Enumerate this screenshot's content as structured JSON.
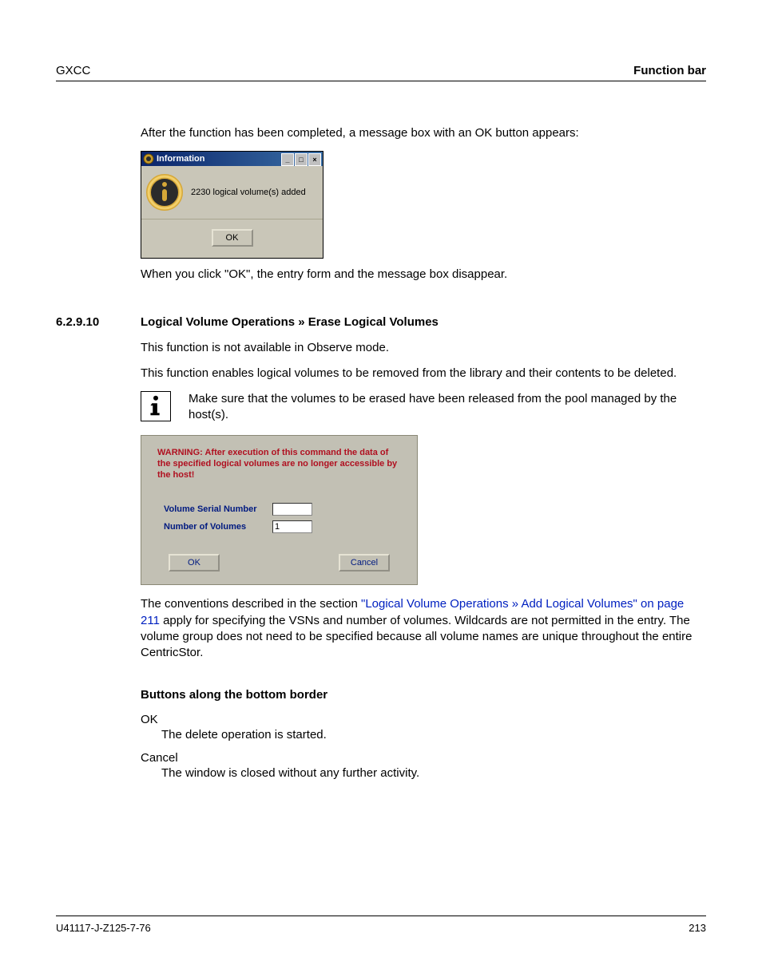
{
  "header": {
    "left": "GXCC",
    "right": "Function bar"
  },
  "intro": "After the function has been completed, a message box with an OK button appears:",
  "info_window": {
    "title": "Information",
    "message": "2230 logical volume(s) added",
    "ok": "OK"
  },
  "after_ok": "When you click \"OK\", the entry form and the message box disappear.",
  "section": {
    "number": "6.2.9.10",
    "title": "Logical Volume Operations » Erase Logical Volumes"
  },
  "body": {
    "p1": "This function is not available in Observe mode.",
    "p2": "This function enables logical volumes to be removed from the library and their contents to be deleted.",
    "note": "Make sure that the volumes to be erased have been released from the pool managed by the host(s).",
    "conventions_pre": "The conventions described in the section ",
    "conventions_link": "\"Logical Volume Operations » Add Logical Volumes\" on page 211",
    "conventions_post": " apply for specifying the VSNs and number of volumes. Wildcards are not permitted in the entry. The volume group does not need to be specified because all volume names are unique throughout the entire CentricStor."
  },
  "erase_form": {
    "warning": "WARNING: After execution of this command the data of the specified logical volumes are no longer accessible by the host!",
    "labels": {
      "vsn": "Volume Serial Number",
      "num": "Number of Volumes"
    },
    "values": {
      "vsn": "",
      "num": "1"
    },
    "ok": "OK",
    "cancel": "Cancel"
  },
  "buttons_section": {
    "title": "Buttons along the bottom border",
    "ok_term": "OK",
    "ok_desc": "The delete operation is started.",
    "cancel_term": "Cancel",
    "cancel_desc": "The window is closed without any further activity."
  },
  "footer": {
    "doc_id": "U41117-J-Z125-7-76",
    "page": "213"
  }
}
